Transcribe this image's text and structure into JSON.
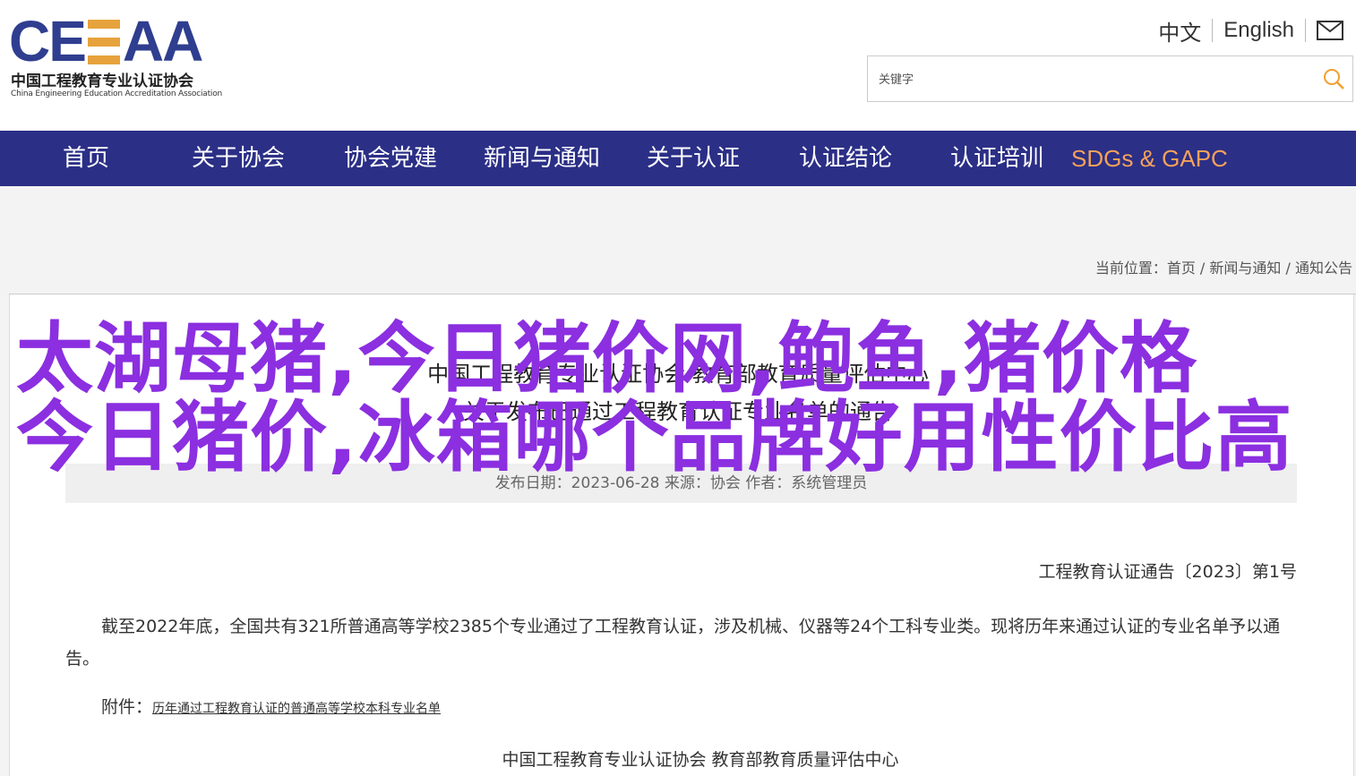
{
  "logo": {
    "mark": "CE",
    "mark_tail": "AA",
    "name_cn": "中国工程教育专业认证协会",
    "name_en": "China Engineering Education Accreditation Association"
  },
  "lang": {
    "cn": "中文",
    "en": "English",
    "mail_icon": "mail-icon"
  },
  "search": {
    "placeholder": "关键字",
    "icon": "search-icon"
  },
  "nav": {
    "items": [
      "首页",
      "关于协会",
      "协会党建",
      "新闻与通知",
      "关于认证",
      "认证结论",
      "认证培训",
      "SDGs & GAPC"
    ]
  },
  "breadcrumb": {
    "prefix": "当前位置：",
    "home": "首页",
    "sep": " / ",
    "news": "新闻与通知",
    "current": "通知公告"
  },
  "article": {
    "title_line1": "中国工程教育专业认证协会 教育部教育质量评估中心",
    "title_line2": "关于发布已通过工程教育认证专业名单的通告",
    "meta": "发布日期：2023-06-28    来源：协会    作者：系统管理员",
    "notice_no": "工程教育认证通告〔2023〕第1号",
    "paragraph": "截至2022年底，全国共有321所普通高等学校2385个专业通过了工程教育认证，涉及机械、仪器等24个工科专业类。现将历年来通过认证的专业名单予以通告。",
    "attachment_label": "附件：",
    "attachment_link": "历年通过工程教育认证的普通高等学校本科专业名单",
    "signature": "中国工程教育专业认证协会     教育部教育质量评估中心"
  },
  "overlay": {
    "line1": "太湖母猪,今日猪价网,鲍鱼,猪价格",
    "line2": "今日猪价,冰箱哪个品牌好用性价比高"
  },
  "colors": {
    "nav_bg": "#2b2f86",
    "accent": "#f5a15a",
    "overlay": "#8b2fe0",
    "logo": "#2f3e8f"
  }
}
